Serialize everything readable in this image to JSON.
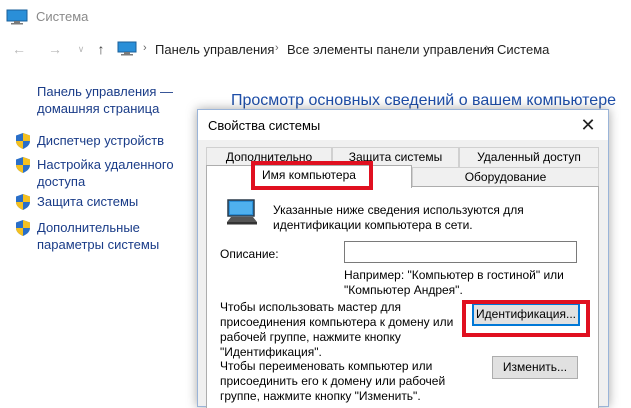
{
  "window": {
    "title": "Система",
    "icon": "computer-icon"
  },
  "addressbar": {
    "back_icon": "arrow-left-icon",
    "forward_icon": "arrow-right-icon",
    "recent_icon": "chevron-down-icon",
    "up_icon": "arrow-up-icon",
    "location_icon": "computer-icon",
    "breadcrumbs": [
      "Панель управления",
      "Все элементы панели управления",
      "Система"
    ]
  },
  "sidebar": {
    "home_link": "Панель управления — домашняя страница",
    "items": [
      {
        "label": "Диспетчер устройств",
        "icon": "uac-shield-icon"
      },
      {
        "label": "Настройка удаленного доступа",
        "icon": "uac-shield-icon"
      },
      {
        "label": "Защита системы",
        "icon": "uac-shield-icon"
      },
      {
        "label": "Дополнительные параметры системы",
        "icon": "uac-shield-icon"
      }
    ]
  },
  "main": {
    "heading": "Просмотр основных сведений о вашем компьютере"
  },
  "dialog": {
    "title": "Свойства системы",
    "close_icon": "close-icon",
    "tabs_row1": [
      "Дополнительно",
      "Защита системы",
      "Удаленный доступ"
    ],
    "tabs_row2": [
      "Имя компьютера",
      "Оборудование"
    ],
    "active_tab": "Имя компьютера",
    "info_text": "Указанные ниже сведения используются для идентификации компьютера в сети.",
    "description_label": "Описание:",
    "description_value": "",
    "example_text": "Например: \"Компьютер в гостиной\" или \"Компьютер Андрея\".",
    "network_id_text": "Чтобы использовать мастер для присоединения компьютера к домену или рабочей группе, нажмите кнопку \"Идентификация\".",
    "network_id_button": "Идентификация...",
    "rename_text": "Чтобы переименовать компьютер или присоединить его к домену или рабочей группе, нажмите кнопку \"Изменить\".",
    "change_button": "Изменить...",
    "highlight_color": "#e01020",
    "accent_color": "#0078d7"
  }
}
